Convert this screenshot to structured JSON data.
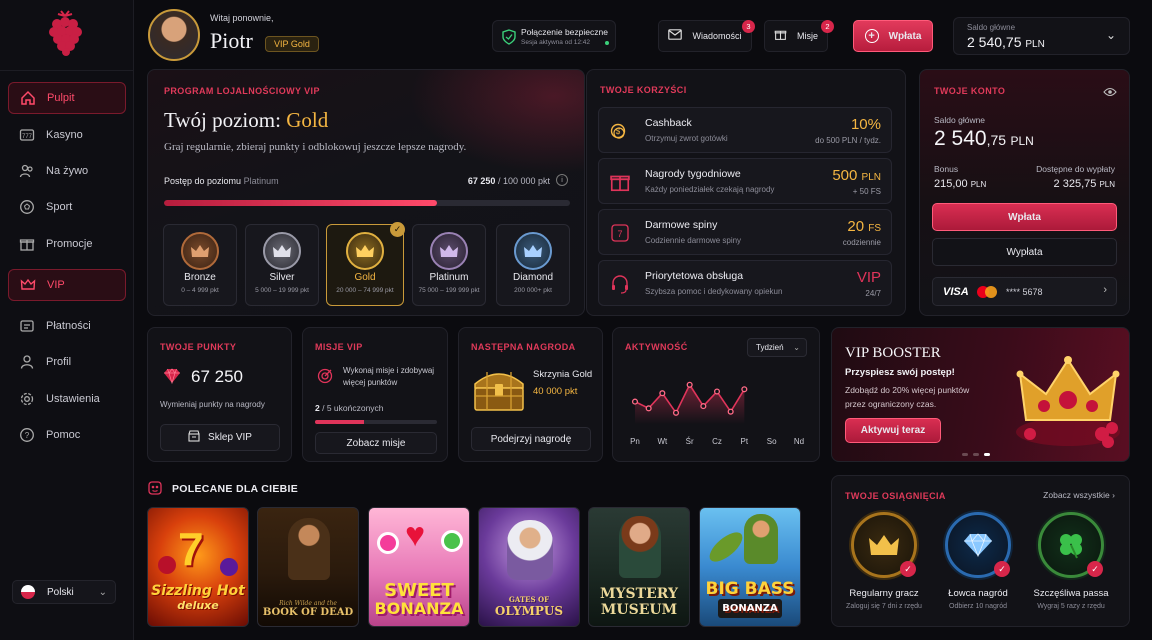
{
  "header": {
    "welcome": "Witaj ponownie,",
    "username": "Piotr",
    "vip_badge": "VIP Gold",
    "secure_title": "Połączenie bezpieczne",
    "secure_sub": "Sesja aktywna od 12:42",
    "messages_label": "Wiadomości",
    "messages_count": "3",
    "missions_label": "Misje",
    "missions_count": "2",
    "deposit_label": "Wpłata",
    "balance_label": "Saldo główne",
    "balance_value": "2 540,75",
    "balance_currency": "PLN"
  },
  "sidebar": {
    "items": [
      {
        "label": "Pulpit"
      },
      {
        "label": "Kasyno"
      },
      {
        "label": "Na żywo"
      },
      {
        "label": "Sport"
      },
      {
        "label": "Promocje"
      },
      {
        "label": "VIP"
      },
      {
        "label": "Płatności"
      },
      {
        "label": "Profil"
      },
      {
        "label": "Ustawienia"
      },
      {
        "label": "Pomoc"
      }
    ],
    "language": "Polski"
  },
  "loyalty": {
    "section_label": "PROGRAM LOJALNOŚCIOWY VIP",
    "title_prefix": "Twój poziom:",
    "title_level": "Gold",
    "subtitle": "Graj regularnie, zbieraj punkty i odblokowuj jeszcze lepsze nagrody.",
    "progress_label": "Postęp do poziomu",
    "progress_target": "Platinum",
    "progress_current": "67 250",
    "progress_total": "/ 100 000 pkt",
    "progress_fraction": 0.6725,
    "tiers": [
      {
        "name": "Bronze",
        "range": "0 – 4 999 pkt"
      },
      {
        "name": "Silver",
        "range": "5 000 – 19 999 pkt"
      },
      {
        "name": "Gold",
        "range": "20 000 – 74 999 pkt"
      },
      {
        "name": "Platinum",
        "range": "75 000 – 199 999 pkt"
      },
      {
        "name": "Diamond",
        "range": "200 000+ pkt"
      }
    ]
  },
  "benefits": {
    "section_label": "TWOJE KORZYŚCI",
    "items": [
      {
        "title": "Cashback",
        "sub": "Otrzymuj zwrot gotówki",
        "value": "10%",
        "note": "do 500 PLN / tydz."
      },
      {
        "title": "Nagrody tygodniowe",
        "sub": "Każdy poniedziałek czekają nagrody",
        "value": "500",
        "value_unit": "PLN",
        "note": "+ 50 FS"
      },
      {
        "title": "Darmowe spiny",
        "sub": "Codziennie darmowe spiny",
        "value": "20",
        "value_unit": "FS",
        "note": "codziennie"
      },
      {
        "title": "Priorytetowa obsługa",
        "sub": "Szybsza pomoc i dedykowany opiekun",
        "value": "VIP",
        "note": "24/7"
      }
    ]
  },
  "account": {
    "section_label": "TWOJE KONTO",
    "main_label": "Saldo główne",
    "main_int": "2 540",
    "main_dec": ",75",
    "main_cur": "PLN",
    "bonus_label": "Bonus",
    "bonus_value": "215,00",
    "bonus_cur": "PLN",
    "withdrawable_label": "Dostępne do wypłaty",
    "withdrawable_value": "2 325,75",
    "withdrawable_cur": "PLN",
    "deposit_btn": "Wpłata",
    "withdraw_btn": "Wypłata",
    "card_brand": "VISA",
    "card_number": "**** 5678"
  },
  "points": {
    "label": "TWOJE PUNKTY",
    "value": "67 250",
    "desc": "Wymieniaj punkty na nagrody",
    "btn": "Sklep VIP"
  },
  "missions": {
    "label": "MISJE VIP",
    "desc": "Wykonaj misje i zdobywaj więcej punktów",
    "done": "2",
    "total": "/ 5 ukończonych",
    "fraction": 0.4,
    "btn": "Zobacz misje"
  },
  "next_reward": {
    "label": "NASTĘPNA NAGRODA",
    "name": "Skrzynia Gold",
    "points": "40 000 pkt",
    "btn": "Podejrzyj nagrodę"
  },
  "activity": {
    "label": "AKTYWNOŚĆ",
    "period": "Tydzień"
  },
  "chart_data": {
    "type": "area",
    "categories": [
      "Pn",
      "Wt",
      "Śr",
      "Cz",
      "Pt",
      "So",
      "Nd"
    ],
    "values": [
      40,
      28,
      55,
      20,
      70,
      32,
      58,
      22,
      62
    ],
    "x": [
      0,
      0.5,
      1,
      1.5,
      2,
      2.5,
      3,
      3.5,
      4
    ],
    "ylim": [
      0,
      100
    ],
    "grid": false,
    "color": "#e0345a"
  },
  "booster": {
    "title": "VIP BOOSTER",
    "subtitle": "Przyspiesz swój postęp!",
    "desc": "Zdobądź do 20% więcej punktów przez ograniczony czas.",
    "btn": "Aktywuj teraz"
  },
  "recommended": {
    "label": "POLECANE DLA CIEBIE",
    "games": [
      {
        "line1": "Sizzling Hot",
        "line2": "deluxe"
      },
      {
        "line1": "BOOK OF DEAD",
        "line2": "Rich Wilde and the"
      },
      {
        "line1": "SWEET",
        "line2": "BONANZA"
      },
      {
        "line1": "GATES OF",
        "line2": "OLYMPUS"
      },
      {
        "line1": "MYSTERY",
        "line2": "MUSEUM"
      },
      {
        "line1": "BIG BASS",
        "line2": "BONANZA"
      }
    ]
  },
  "achievements": {
    "label": "TWOJE OSIĄGNIĘCIA",
    "see_all": "Zobacz wszystkie",
    "items": [
      {
        "name": "Regularny gracz",
        "desc": "Zaloguj się 7 dni z rzędu"
      },
      {
        "name": "Łowca nagród",
        "desc": "Odbierz 10 nagród"
      },
      {
        "name": "Szczęśliwa passa",
        "desc": "Wygraj 5 razy z rzędu"
      }
    ]
  },
  "colors": {
    "accent": "#e0345a",
    "gold": "#f5b642",
    "bg": "#0b0b0f"
  }
}
